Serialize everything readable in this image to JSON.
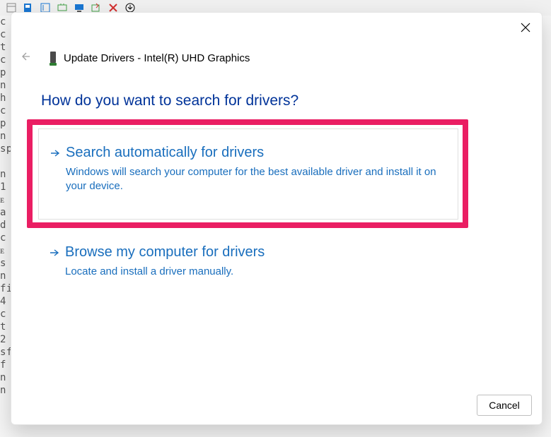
{
  "bg_left_chars": "c\nc\nt\nc\np\nn\nh\nc\np\nn\nsp\n \nn\n1\nᴇ\na\nd\nc\nᴇ\ns\nn\nfi\n4\nc\nt\n2\nsf\nf\nn\nn",
  "window": {
    "title": "Update Drivers - Intel(R) UHD Graphics",
    "heading": "How do you want to search for drivers?"
  },
  "options": [
    {
      "title": "Search automatically for drivers",
      "description": "Windows will search your computer for the best available driver and install it on your device."
    },
    {
      "title": "Browse my computer for drivers",
      "description": "Locate and install a driver manually."
    }
  ],
  "buttons": {
    "cancel": "Cancel"
  }
}
